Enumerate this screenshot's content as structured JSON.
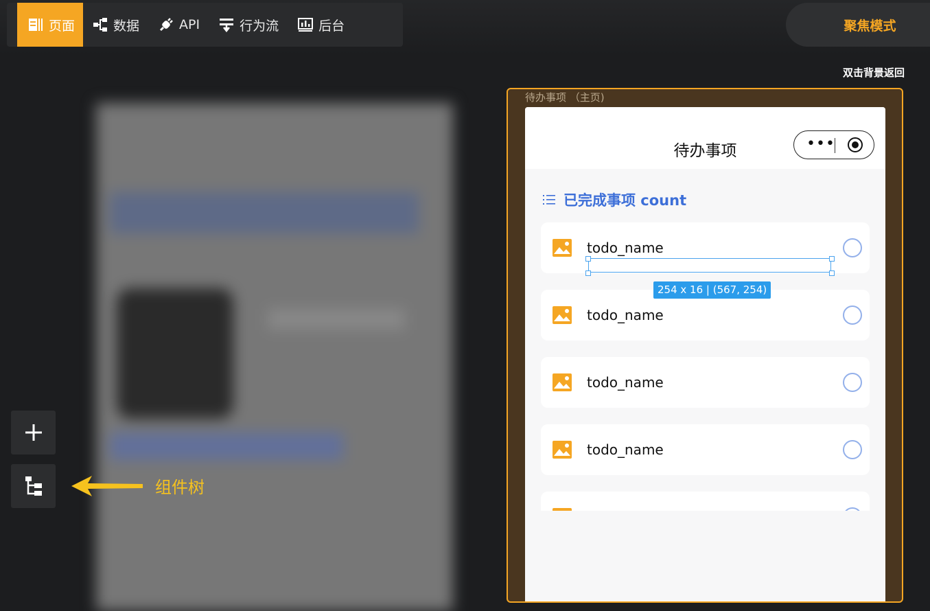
{
  "nav": {
    "items": [
      {
        "label": "页面",
        "icon": "page-icon",
        "active": true
      },
      {
        "label": "数据",
        "icon": "data-tree-icon"
      },
      {
        "label": "API",
        "icon": "plug-icon"
      },
      {
        "label": "行为流",
        "icon": "flow-icon"
      },
      {
        "label": "后台",
        "icon": "dashboard-icon"
      }
    ],
    "accent": "#f5a623"
  },
  "focus_mode": {
    "label": "聚焦模式"
  },
  "hint": "双击背景返回",
  "tools": {
    "add_icon": "plus-icon",
    "tree_icon": "component-tree-icon",
    "tree_label": "组件树"
  },
  "preview": {
    "frame_title": "待办事项 （主页)",
    "page_title": "待办事项",
    "section_title": "已完成事项  count",
    "items": [
      {
        "name": "todo_name"
      },
      {
        "name": "todo_name"
      },
      {
        "name": "todo_name"
      },
      {
        "name": "todo_name"
      }
    ],
    "selection_badge": "254 x 16 | (567, 254)",
    "link_color": "#3d6fd8"
  }
}
